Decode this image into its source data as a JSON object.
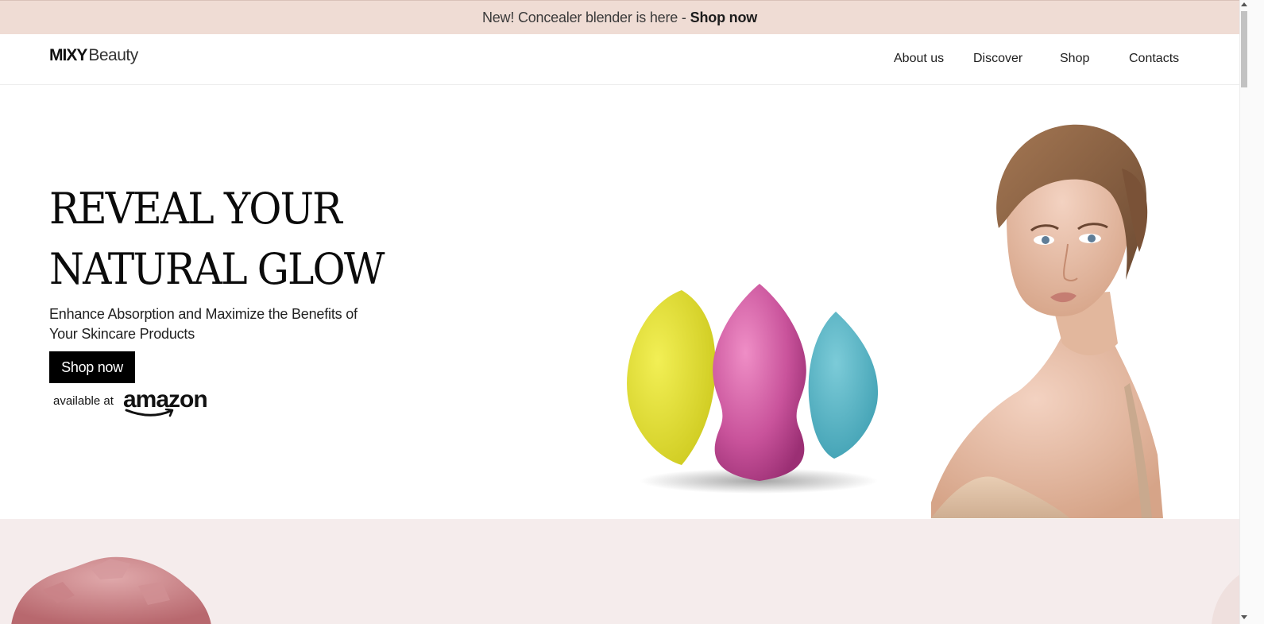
{
  "announcement": {
    "text": "New! Concealer blender is here -",
    "link": "Shop now"
  },
  "header": {
    "logo_bold": "MIXY",
    "logo_light": "Beauty",
    "nav": [
      "About us",
      "Discover",
      "Shop",
      "Contacts"
    ]
  },
  "hero": {
    "headline_line1": "REVEAL YOUR",
    "headline_line2": "NATURAL GLOW",
    "subtitle": "Enhance Absorption and Maximize the Benefits of Your Skincare Products",
    "cta": "Shop now",
    "available_text": "available at",
    "retailer": "amazon"
  },
  "colors": {
    "announcement_bg": "#efdcd4",
    "section2_bg": "#f5ecec",
    "cta_bg": "#000000",
    "sponge_yellow": "#e6e33a",
    "sponge_pink": "#c9539b",
    "sponge_teal": "#59b4c6"
  },
  "icons": [
    "amazon-smile-icon",
    "scroll-up-arrow-icon",
    "scroll-down-arrow-icon"
  ]
}
